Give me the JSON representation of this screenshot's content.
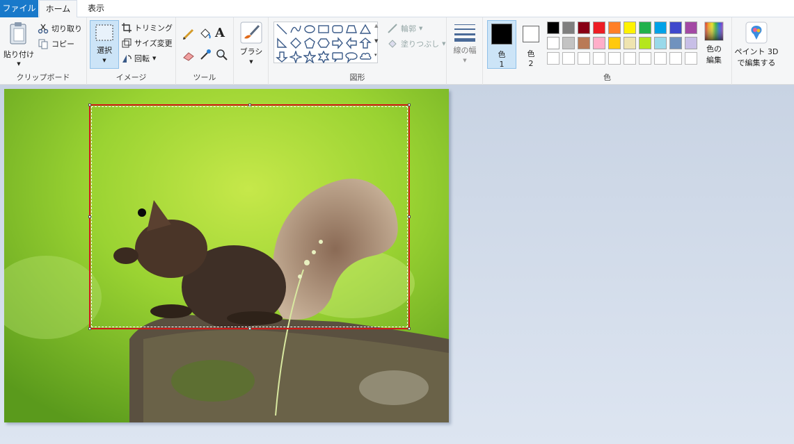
{
  "tabs": [
    {
      "label": "ファイル"
    },
    {
      "label": "ホーム"
    },
    {
      "label": "表示"
    }
  ],
  "clipboard": {
    "paste": "貼り付け",
    "cut": "切り取り",
    "copy": "コピー",
    "group": "クリップボード"
  },
  "image": {
    "select": "選択",
    "crop": "トリミング",
    "resize": "サイズ変更",
    "rotate": "回転",
    "group": "イメージ"
  },
  "tools": {
    "group": "ツール",
    "icons": [
      "pencil-icon",
      "fill-icon",
      "text-icon",
      "eraser-icon",
      "color-picker-icon",
      "magnifier-icon"
    ]
  },
  "brushes": {
    "label": "ブラシ"
  },
  "shapes": {
    "group": "図形",
    "outline": "輪郭",
    "fill": "塗りつぶし",
    "items": [
      "line",
      "curve",
      "oval",
      "rectangle",
      "rounded-rectangle",
      "polygon",
      "triangle",
      "right-triangle",
      "diamond",
      "pentagon",
      "hexagon",
      "right-arrow",
      "left-arrow",
      "up-arrow",
      "down-arrow",
      "four-point-star",
      "five-point-star",
      "six-point-star",
      "rounded-callout",
      "oval-callout",
      "cloud-callout"
    ]
  },
  "size": {
    "label": "線の幅"
  },
  "colors": {
    "color1_label": "色",
    "color1_num": "1",
    "color2_label": "色",
    "color2_num": "2",
    "edit_label_1": "色の",
    "edit_label_2": "編集",
    "group": "色",
    "color1_value": "#000000",
    "color2_value": "#ffffff",
    "palette_row1": [
      "#000000",
      "#7f7f7f",
      "#880015",
      "#ed1c24",
      "#ff7f27",
      "#fff200",
      "#22b14c",
      "#00a2e8",
      "#3f48cc",
      "#a349a4"
    ],
    "palette_row2": [
      "#ffffff",
      "#c3c3c3",
      "#b97a57",
      "#ffaec9",
      "#ffc90e",
      "#efe4b0",
      "#b5e61d",
      "#99d9ea",
      "#7092be",
      "#c8bfe7"
    ]
  },
  "paint3d": {
    "label1": "ペイント 3D",
    "label2": "で編集する"
  }
}
